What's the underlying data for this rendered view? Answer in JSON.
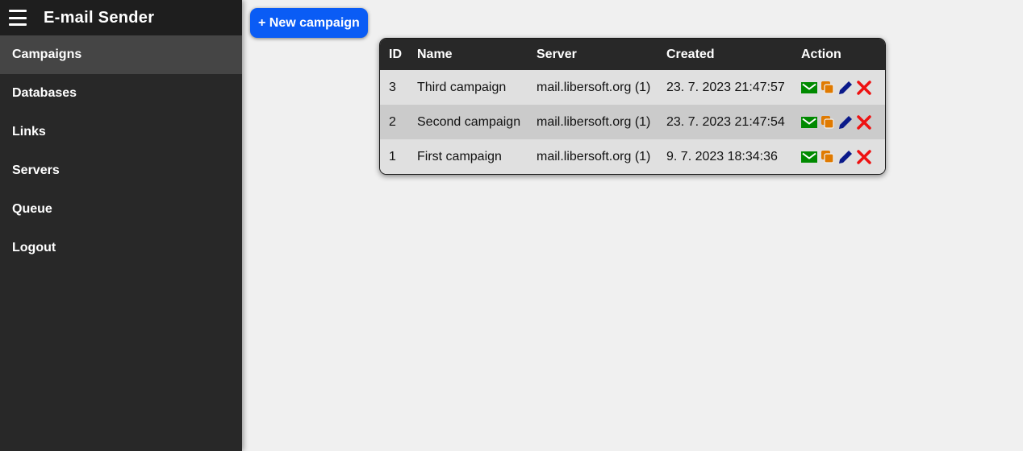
{
  "app": {
    "title": "E-mail Sender"
  },
  "sidebar": {
    "items": [
      {
        "label": "Campaigns",
        "active": true
      },
      {
        "label": "Databases"
      },
      {
        "label": "Links"
      },
      {
        "label": "Servers"
      },
      {
        "label": "Queue"
      },
      {
        "label": "Logout"
      }
    ]
  },
  "toolbar": {
    "new_campaign_label": "+ New campaign"
  },
  "table": {
    "headers": [
      "ID",
      "Name",
      "Server",
      "Created",
      "Action"
    ],
    "rows": [
      {
        "id": "3",
        "name": "Third campaign",
        "server": "mail.libersoft.org (1)",
        "created": "23. 7. 2023 21:47:57"
      },
      {
        "id": "2",
        "name": "Second campaign",
        "server": "mail.libersoft.org (1)",
        "created": "23. 7. 2023 21:47:54"
      },
      {
        "id": "1",
        "name": "First campaign",
        "server": "mail.libersoft.org (1)",
        "created": "9. 7. 2023 18:34:36"
      }
    ],
    "action_icons": [
      "send-mail-icon",
      "copy-icon",
      "edit-pencil-icon",
      "delete-x-icon"
    ]
  },
  "colors": {
    "sidebar_bg": "#282828",
    "topbar_bg": "#1e1e1e",
    "active_item_bg": "#454545",
    "accent_button": "#0a5cf5",
    "mail_icon": "#008a00",
    "copy_icon": "#e07a00",
    "edit_icon": "#0a1a8a",
    "delete_icon": "#ee1111"
  }
}
